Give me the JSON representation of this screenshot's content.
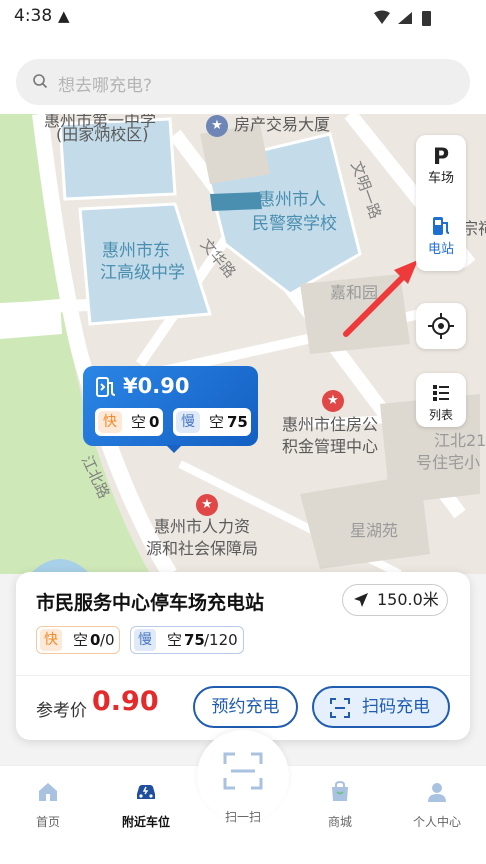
{
  "status_bar": {
    "time": "4:38",
    "warning_icon": "warning-icon",
    "system_icons": "▾ ◢ ▮"
  },
  "search": {
    "placeholder": "想去哪充电?"
  },
  "map": {
    "labels": {
      "school1_line1": "惠州市第一中学",
      "school1_line2": "(田家炳校区)",
      "building": "房产交易大厦",
      "road1": "文明一路",
      "police_school_line1": "惠州市人",
      "police_school_line2": "民警察学校",
      "school2_line1": "惠州市东",
      "school2_line2": "江高级中学",
      "road2": "文华路",
      "jiahe": "嘉和园",
      "zong": "宗祠",
      "housing_line1": "惠州市住房公",
      "housing_line2": "积金管理中心",
      "jiangbei_line1": "江北21",
      "jiangbei_line2": "号住宅小",
      "road3": "江北路",
      "hr_line1": "惠州市人力资",
      "hr_line2": "源和社会保障局",
      "xinghu": "星湖苑"
    }
  },
  "side_buttons": {
    "parking": {
      "glyph": "P",
      "label": "车场"
    },
    "station": {
      "label": "电站"
    },
    "locate_icon": "crosshair-icon",
    "list": {
      "label": "列表"
    }
  },
  "marker": {
    "price": "¥0.90",
    "fast_tag": "快",
    "fast_text": "空",
    "fast_count": "0",
    "slow_tag": "慢",
    "slow_text": "空",
    "slow_count": "75"
  },
  "station_card": {
    "name": "市民服务中心停车场充电站",
    "distance": "150.0米",
    "fast": {
      "tag": "快",
      "label": "空",
      "free": "0",
      "total": "/0"
    },
    "slow": {
      "tag": "慢",
      "label": "空",
      "free": "75",
      "total": "/120"
    },
    "price_label": "参考价",
    "price_value": "0.90",
    "reserve_button": "预约充电",
    "scan_button": "扫码充电"
  },
  "tabs": [
    {
      "label": "首页",
      "icon": "home-icon"
    },
    {
      "label": "附近车位",
      "icon": "car-icon",
      "active": true
    },
    {
      "label": "扫一扫",
      "icon": "scan-icon"
    },
    {
      "label": "商城",
      "icon": "bag-icon"
    },
    {
      "label": "个人中心",
      "icon": "user-icon"
    }
  ],
  "colors": {
    "accent": "#1f5cb0",
    "price_red": "#e32b2b",
    "fast_orange": "#f08a2a",
    "slow_blue": "#4a78c0"
  }
}
